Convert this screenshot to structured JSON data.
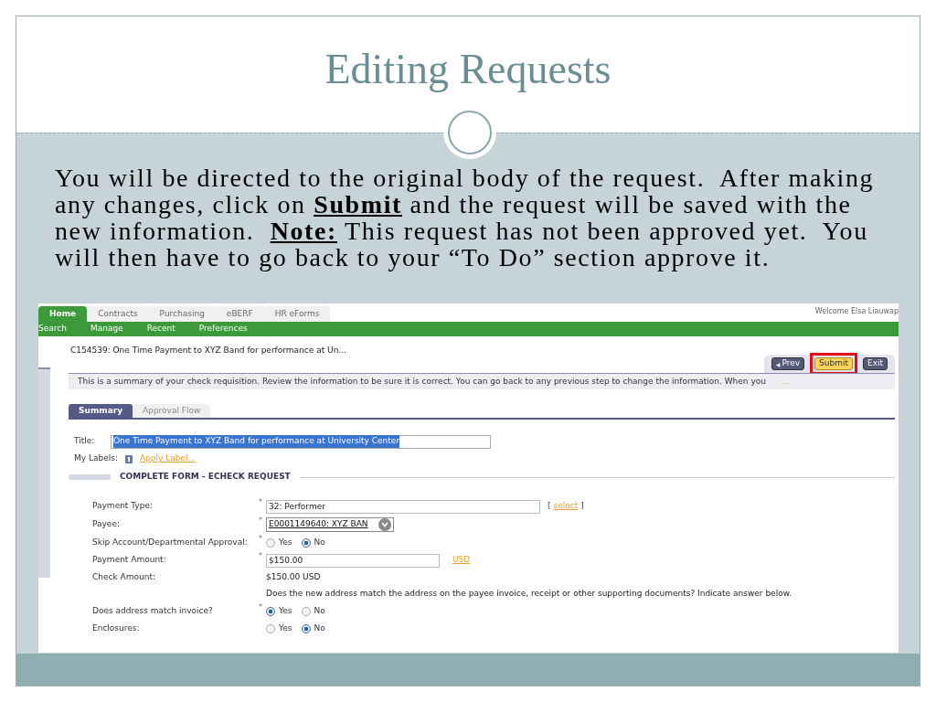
{
  "slide": {
    "title": "Editing Requests",
    "body": [
      {
        "kind": "plain",
        "text": "You will be directed to the original body of the request.  After making any changes, click on "
      },
      {
        "kind": "emphasis",
        "text": "Submit"
      },
      {
        "kind": "plain",
        "text": " and the request will be saved with the new information.  "
      },
      {
        "kind": "emphasis",
        "text": "Note:"
      },
      {
        "kind": "plain",
        "text": " This request has not been approved yet.  You will then have to go back to your “To Do” section approve it."
      }
    ]
  },
  "app": {
    "top_tabs": [
      {
        "label": "Home",
        "selected": true
      },
      {
        "label": "Contracts",
        "selected": false
      },
      {
        "label": "Purchasing",
        "selected": false
      },
      {
        "label": "eBERF",
        "selected": false
      },
      {
        "label": "HR eForms",
        "selected": false
      }
    ],
    "welcome": "Welcome Elsa Liauwap",
    "sub_nav": [
      "Search",
      "Manage",
      "Recent",
      "Preferences"
    ],
    "request_title": "C154539: One Time Payment to XYZ Band for performance at Un...",
    "buttons": [
      {
        "kind": "prev",
        "icon": "◀",
        "label": "Prev",
        "highlighted": false
      },
      {
        "kind": "submit",
        "label": "Submit",
        "highlighted": true
      },
      {
        "kind": "exit",
        "label": "Exit",
        "highlighted": false
      }
    ],
    "summary_text": "This is a summary of your check requisition. Review the information to be sure it is correct. You can go back to any previous step to change the information. When you",
    "summary_more": "...",
    "view_tabs": [
      {
        "label": "Summary",
        "selected": true
      },
      {
        "label": "Approval Flow",
        "selected": false
      }
    ],
    "title_field": {
      "label": "Title:",
      "value": "One Time Payment to XYZ Band for performance at University Center"
    },
    "labels_row": {
      "label": "My Labels:",
      "link": "Apply Label..."
    },
    "section_title": "COMPLETE FORM - ECHECK REQUEST",
    "rows": [
      {
        "kind": "text_select",
        "label": "Payment Type:",
        "required_mark": "*",
        "value": "32: Performer",
        "prefix": "[",
        "link": "select",
        "suffix": "]"
      },
      {
        "kind": "dropdown",
        "label": "Payee:",
        "required_mark": "*",
        "value": "E0001149640: XYZ BAN"
      },
      {
        "kind": "radio",
        "label": "Skip Account/Departmental Approval:",
        "required_mark": "*",
        "options": [
          {
            "label": "Yes",
            "selected": false
          },
          {
            "label": "No",
            "selected": true
          }
        ]
      },
      {
        "kind": "amount",
        "label": "Payment Amount:",
        "required_mark": "*",
        "value": "$150.00",
        "link": "USD"
      },
      {
        "kind": "static",
        "label": "Check Amount:",
        "value": "$150.00 USD"
      },
      {
        "kind": "note",
        "text": "Does the new address match the address on the payee invoice, receipt or other supporting documents? Indicate answer below."
      },
      {
        "kind": "radio",
        "label": "Does address match invoice?",
        "required_mark": "*",
        "options": [
          {
            "label": "Yes",
            "selected": true
          },
          {
            "label": "No",
            "selected": false
          }
        ]
      },
      {
        "kind": "radio",
        "label": "Enclosures:",
        "options": [
          {
            "label": "Yes",
            "selected": false
          },
          {
            "label": "No",
            "selected": true
          }
        ]
      }
    ]
  }
}
